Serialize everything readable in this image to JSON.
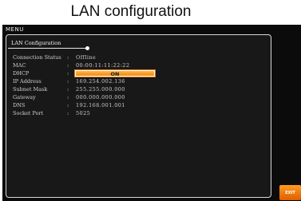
{
  "caption": "LAN configuration",
  "screen": {
    "menu_label": "MENU",
    "tab_title": "LAN Configuration",
    "rows": [
      {
        "label": "Connection Status",
        "value": "Offline"
      },
      {
        "label": "MAC",
        "value": "00:00:11:11:22:22"
      },
      {
        "label": "DHCP",
        "value": "ON"
      },
      {
        "label": "IP Address",
        "value": "169.254.002.136"
      },
      {
        "label": "Subnet Mask",
        "value": "255.255.000.000"
      },
      {
        "label": "Gateway",
        "value": "000.000.000.000"
      },
      {
        "label": "DNS",
        "value": "192.168.001.001"
      },
      {
        "label": "Socket Port",
        "value": "5025"
      }
    ],
    "colon": ":",
    "exit_label": "EXIT"
  },
  "colors": {
    "screen_bg": "#0b0b0b",
    "accent_orange": "#f08a10",
    "text": "#d0d0d0"
  }
}
